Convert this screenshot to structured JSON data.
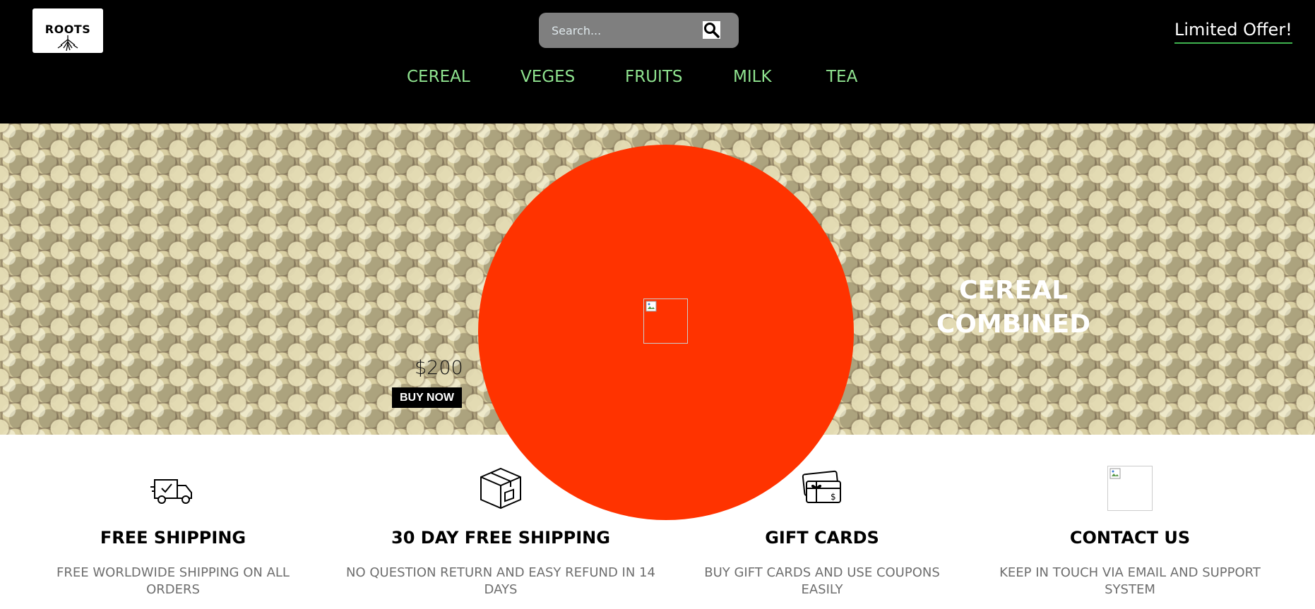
{
  "header": {
    "logo_text": "ROOTS",
    "search_placeholder": "Search...",
    "offer_label": "Limited Offer!"
  },
  "nav": {
    "items": [
      {
        "label": "CEREAL"
      },
      {
        "label": "VEGES"
      },
      {
        "label": "FRUITS"
      },
      {
        "label": "MILK"
      },
      {
        "label": "TEA"
      }
    ]
  },
  "hero": {
    "price": "$200",
    "buy_label": "BUY NOW",
    "title_line1": "CEREAL",
    "title_line2": "COMBINED"
  },
  "features": [
    {
      "icon": "delivery-truck-icon",
      "title": "FREE SHIPPING",
      "desc_line1": "FREE WORLDWIDE SHIPPING ON ALL",
      "desc_line2": "ORDERS"
    },
    {
      "icon": "package-box-icon",
      "title": "30 DAY FREE SHIPPING",
      "desc_line1": "NO QUESTION RETURN AND EASY REFUND IN 14",
      "desc_line2": "DAYS"
    },
    {
      "icon": "gift-card-icon",
      "title": "GIFT CARDS",
      "desc_line1": "BUY GIFT CARDS AND USE COUPONS",
      "desc_line2": "EASILY"
    },
    {
      "icon": "broken-image-icon",
      "title": "CONTACT US",
      "desc_line1": "KEEP IN TOUCH VIA EMAIL AND SUPPORT",
      "desc_line2": "SYSTEM"
    }
  ],
  "colors": {
    "header_bg": "#000000",
    "nav_text": "#8fe38f",
    "circle": "#ff3300",
    "offer_underline": "#3fb24f"
  }
}
